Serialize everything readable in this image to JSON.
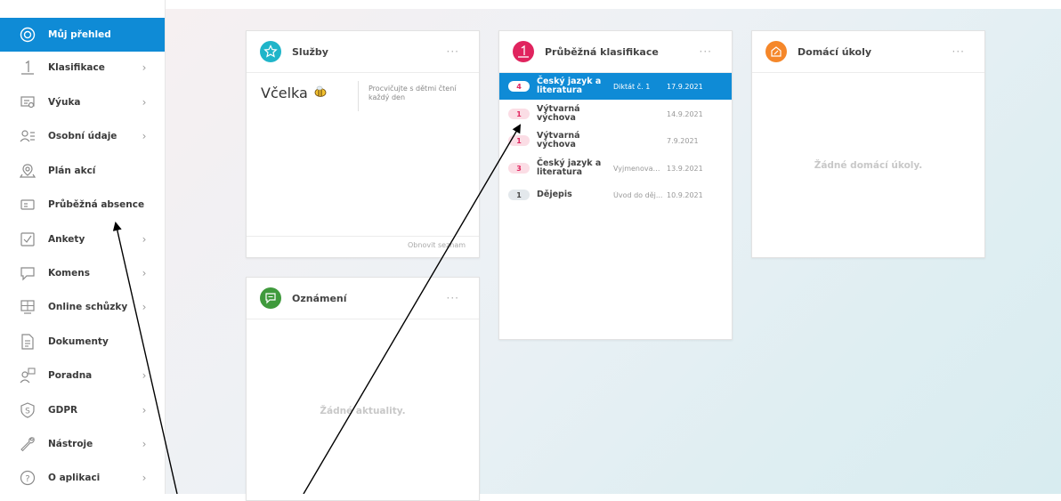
{
  "sidebar": {
    "items": [
      {
        "label": "Můj přehled",
        "icon": "dashboard-icon",
        "chevron": false,
        "active": true
      },
      {
        "label": "Klasifikace",
        "icon": "grade-one-icon",
        "chevron": true
      },
      {
        "label": "Výuka",
        "icon": "lesson-icon",
        "chevron": true
      },
      {
        "label": "Osobní údaje",
        "icon": "personal-data-icon",
        "chevron": true
      },
      {
        "label": "Plán akcí",
        "icon": "map-pin-icon",
        "chevron": false
      },
      {
        "label": "Průběžná absence",
        "icon": "absence-icon",
        "chevron": false
      },
      {
        "label": "Ankety",
        "icon": "checkbox-icon",
        "chevron": true
      },
      {
        "label": "Komens",
        "icon": "chat-icon",
        "chevron": true
      },
      {
        "label": "Online schůzky",
        "icon": "video-meeting-icon",
        "chevron": true
      },
      {
        "label": "Dokumenty",
        "icon": "document-icon",
        "chevron": false
      },
      {
        "label": "Poradna",
        "icon": "counselling-icon",
        "chevron": true
      },
      {
        "label": "GDPR",
        "icon": "gdpr-shield-icon",
        "chevron": true
      },
      {
        "label": "Nástroje",
        "icon": "wrench-icon",
        "chevron": true
      },
      {
        "label": "O aplikaci",
        "icon": "help-icon",
        "chevron": true
      }
    ],
    "chevron_glyph": "›"
  },
  "cards": {
    "sluzby": {
      "title": "Služby",
      "menu": "···",
      "service_name": "Včelka",
      "service_desc": "Procvičujte s dětmi čtení každý den",
      "footer": "Obnovit seznam",
      "icon_color": "#1fb5c9"
    },
    "oznameni": {
      "title": "Oznámení",
      "menu": "···",
      "empty": "Žádné aktuality.",
      "icon_color": "#3f9a3c"
    },
    "klasifikace": {
      "title": "Průběžná klasifikace",
      "menu": "···",
      "icon_glyph": "1",
      "icon_color": "#e0245e",
      "rows": [
        {
          "grade": "4",
          "subject": "Český jazyk a literatura",
          "theme": "Diktát č. 1",
          "date": "17.9.2021",
          "selected": true
        },
        {
          "grade": "1",
          "subject": "Výtvarná výchova",
          "theme": "",
          "date": "14.9.2021"
        },
        {
          "grade": "1",
          "subject": "Výtvarná výchova",
          "theme": "",
          "date": "7.9.2021"
        },
        {
          "grade": "3",
          "subject": "Český jazyk a literatura",
          "theme": "Vyjmenovan...",
          "date": "13.9.2021"
        },
        {
          "grade": "1",
          "subject": "Dějepis",
          "theme": "Úvod do děj...",
          "date": "10.9.2021"
        }
      ]
    },
    "ukoly": {
      "title": "Domácí úkoly",
      "menu": "···",
      "empty": "Žádné domácí úkoly.",
      "icon_color": "#f5872a"
    }
  },
  "colors": {
    "accent": "#0f8bd6"
  }
}
